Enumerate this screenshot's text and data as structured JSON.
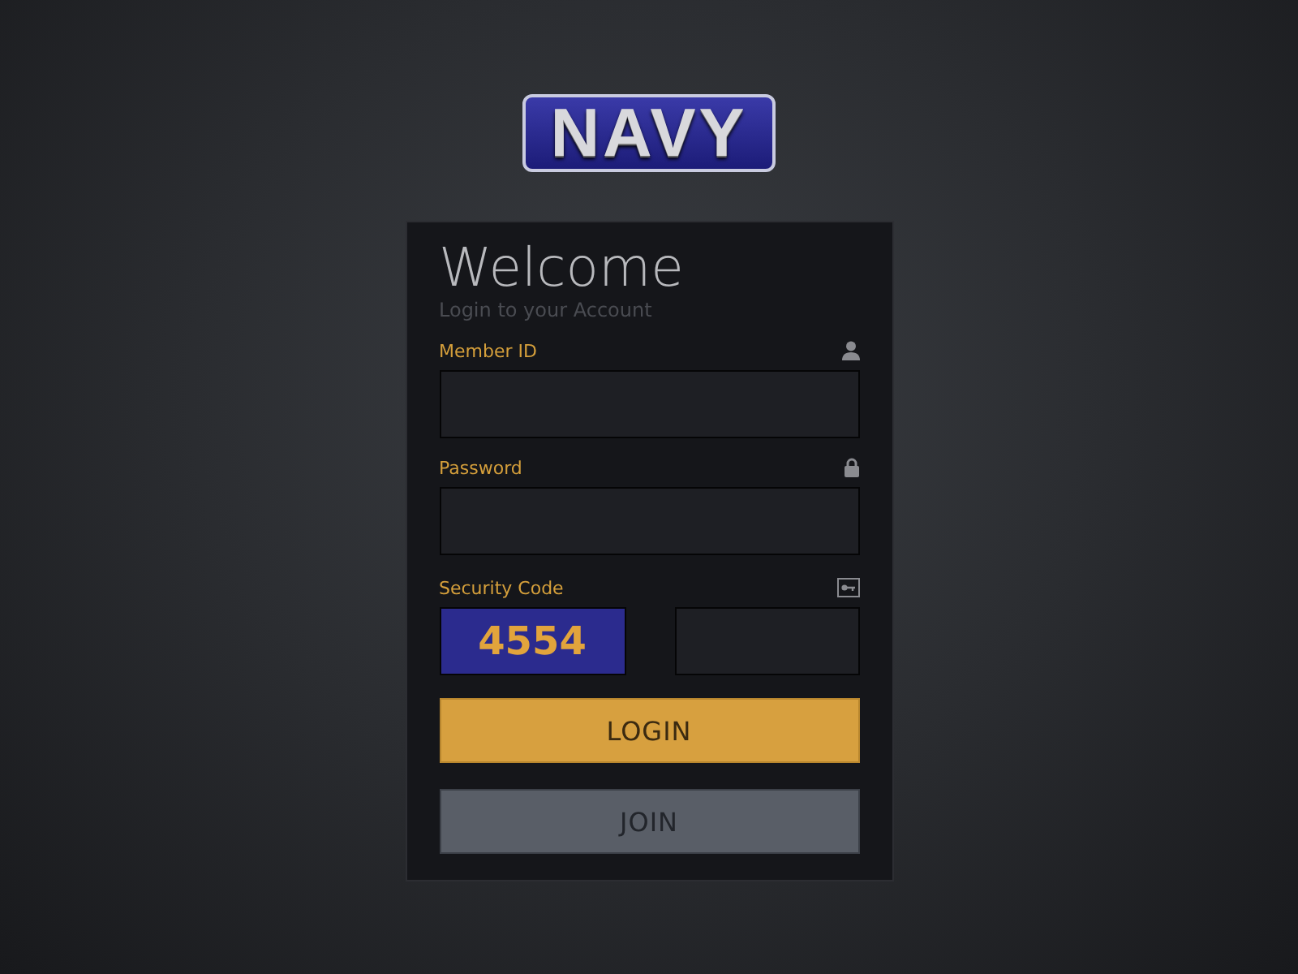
{
  "logo": {
    "text": "NAVY"
  },
  "title": "Welcome",
  "subtitle": "Login to your Account",
  "fields": [
    {
      "kind": "user",
      "label": "Member ID"
    },
    {
      "kind": "password",
      "label": "Password"
    }
  ],
  "security": {
    "label": "Security Code",
    "code": "4554"
  },
  "buttons": [
    {
      "kind": "primary",
      "label": "LOGIN"
    },
    {
      "kind": "secondary",
      "label": "JOIN"
    }
  ]
}
